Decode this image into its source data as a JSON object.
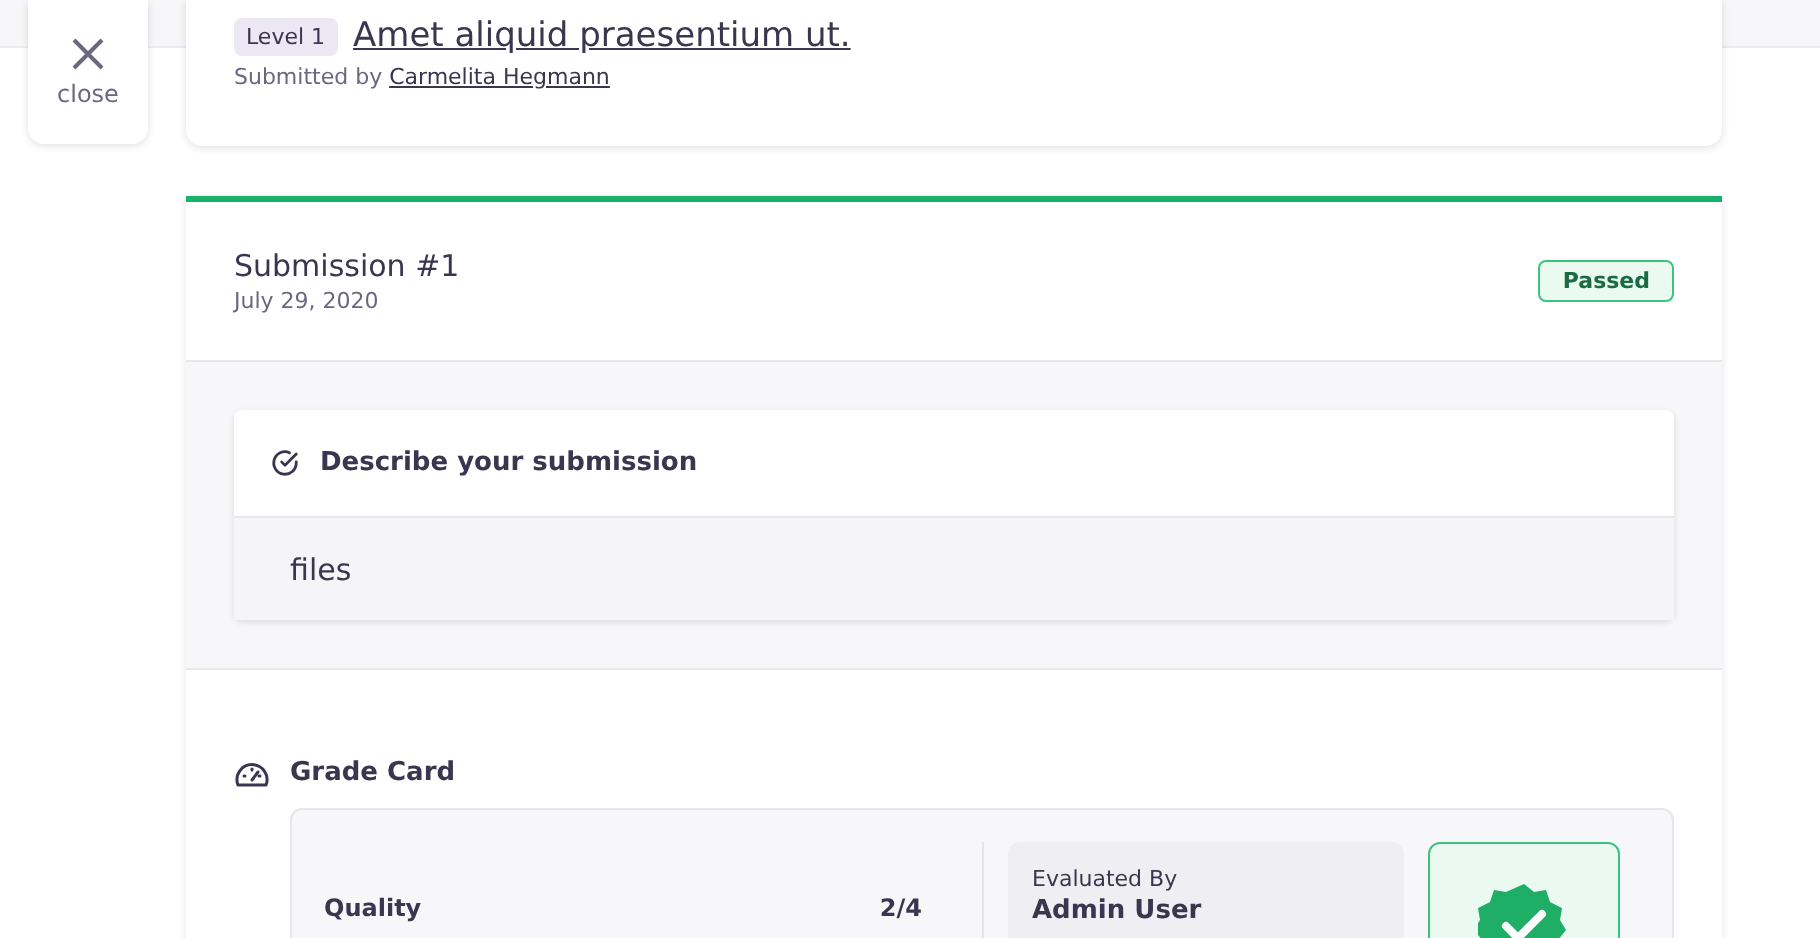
{
  "close_button": {
    "label": "close"
  },
  "header": {
    "level_badge": "Level 1",
    "title": "Amet aliquid praesentium ut.",
    "submitted_prefix": "Submitted by",
    "submitter": "Carmelita Hegmann"
  },
  "submission": {
    "title": "Submission #1",
    "date": "July 29, 2020",
    "status": "Passed",
    "question": {
      "label": "Describe your submission",
      "answer": "files"
    }
  },
  "grade_card": {
    "title": "Grade Card",
    "criteria": [
      {
        "name": "Quality",
        "grade": "2/4"
      }
    ],
    "evaluated_by_label": "Evaluated By",
    "evaluator": "Admin User"
  }
}
